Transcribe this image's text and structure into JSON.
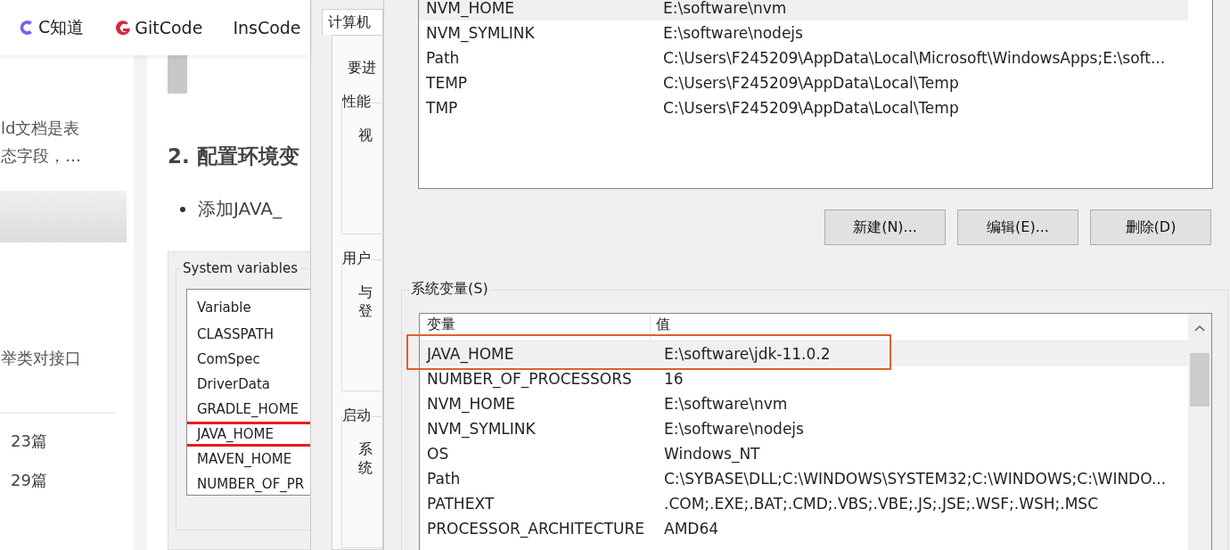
{
  "nav": [
    {
      "label": "C知道",
      "kind": "c"
    },
    {
      "label": "GitCode",
      "kind": "g"
    },
    {
      "label": "InsCode",
      "kind": "plain"
    }
  ],
  "sidebar": {
    "snippet_lines": [
      "ld文档是表",
      "态字段，…"
    ],
    "line_2": "举类对接口",
    "counts": [
      "23篇",
      "29篇"
    ]
  },
  "article": {
    "heading": "2. 配置环境变",
    "bullet": "添加JAVA_",
    "figure": {
      "group_label": "System variables",
      "header": "Variable",
      "rows": [
        {
          "name": "CLASSPATH",
          "annotated": false
        },
        {
          "name": "ComSpec",
          "annotated": false
        },
        {
          "name": "DriverData",
          "annotated": false
        },
        {
          "name": "GRADLE_HOME",
          "annotated": false
        },
        {
          "name": "JAVA_HOME",
          "annotated": true
        },
        {
          "name": "MAVEN_HOME",
          "annotated": false
        },
        {
          "name": "NUMBER_OF_PR",
          "annotated": false
        }
      ]
    }
  },
  "system_properties": {
    "tab": "计算机",
    "intro": "要进",
    "groups": [
      {
        "label": "性能",
        "text": "视"
      },
      {
        "label": "用户",
        "text": "与登"
      },
      {
        "label": "启动",
        "text": "系统"
      }
    ]
  },
  "environment_variables": {
    "user_variables": {
      "rows": [
        {
          "name": "NVM_HOME",
          "value": "E:\\software\\nvm",
          "selected": true
        },
        {
          "name": "NVM_SYMLINK",
          "value": "E:\\software\\nodejs",
          "selected": false
        },
        {
          "name": "Path",
          "value": "C:\\Users\\F245209\\AppData\\Local\\Microsoft\\WindowsApps;E:\\soft...",
          "selected": false
        },
        {
          "name": "TEMP",
          "value": "C:\\Users\\F245209\\AppData\\Local\\Temp",
          "selected": false
        },
        {
          "name": "TMP",
          "value": "C:\\Users\\F245209\\AppData\\Local\\Temp",
          "selected": false
        }
      ]
    },
    "buttons": [
      "新建(N)...",
      "编辑(E)...",
      "删除(D)"
    ],
    "system_variables": {
      "label": "系统变量(S)",
      "columns": [
        "变量",
        "值"
      ],
      "rows": [
        {
          "name": "JAVA_HOME",
          "value": "E:\\software\\jdk-11.0.2",
          "selected": true,
          "annotated": true
        },
        {
          "name": "NUMBER_OF_PROCESSORS",
          "value": "16",
          "selected": false,
          "annotated": false
        },
        {
          "name": "NVM_HOME",
          "value": "E:\\software\\nvm",
          "selected": false,
          "annotated": false
        },
        {
          "name": "NVM_SYMLINK",
          "value": "E:\\software\\nodejs",
          "selected": false,
          "annotated": false
        },
        {
          "name": "OS",
          "value": "Windows_NT",
          "selected": false,
          "annotated": false
        },
        {
          "name": "Path",
          "value": "C:\\SYBASE\\DLL;C:\\WINDOWS\\SYSTEM32;C:\\WINDOWS;C:\\WINDO...",
          "selected": false,
          "annotated": false
        },
        {
          "name": "PATHEXT",
          "value": ".COM;.EXE;.BAT;.CMD;.VBS;.VBE;.JS;.JSE;.WSF;.WSH;.MSC",
          "selected": false,
          "annotated": false
        },
        {
          "name": "PROCESSOR_ARCHITECTURE",
          "value": "AMD64",
          "selected": false,
          "annotated": false
        }
      ]
    }
  }
}
